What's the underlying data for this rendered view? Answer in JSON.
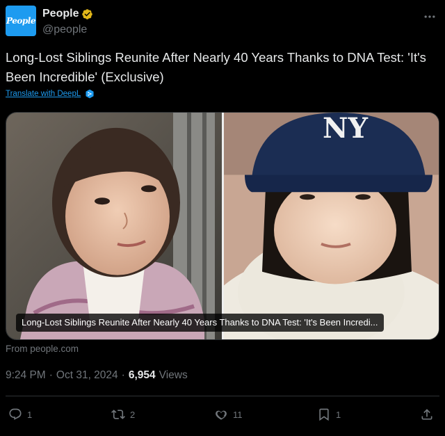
{
  "account": {
    "avatar_text": "People",
    "display_name": "People",
    "handle": "@people"
  },
  "tweet": {
    "text": "Long-Lost Siblings Reunite After Nearly 40 Years Thanks to DNA Test: 'It's Been Incredible' (Exclusive)",
    "translate_label": "Translate with DeepL"
  },
  "media": {
    "caption": "Long-Lost Siblings Reunite After Nearly 40 Years Thanks to DNA Test: 'It's Been Incredi...",
    "source": "From people.com"
  },
  "meta": {
    "time": "9:24 PM",
    "dot1": "·",
    "date": "Oct 31, 2024",
    "dot2": "·",
    "views_count": "6,954",
    "views_label": "Views"
  },
  "actions": {
    "replies": "1",
    "reposts": "2",
    "likes": "11",
    "bookmarks": "1"
  },
  "colors": {
    "accent": "#1d9bf0",
    "verified": "#e2b719",
    "muted": "#71767b",
    "text": "#e7e9ea",
    "background": "#000000"
  }
}
